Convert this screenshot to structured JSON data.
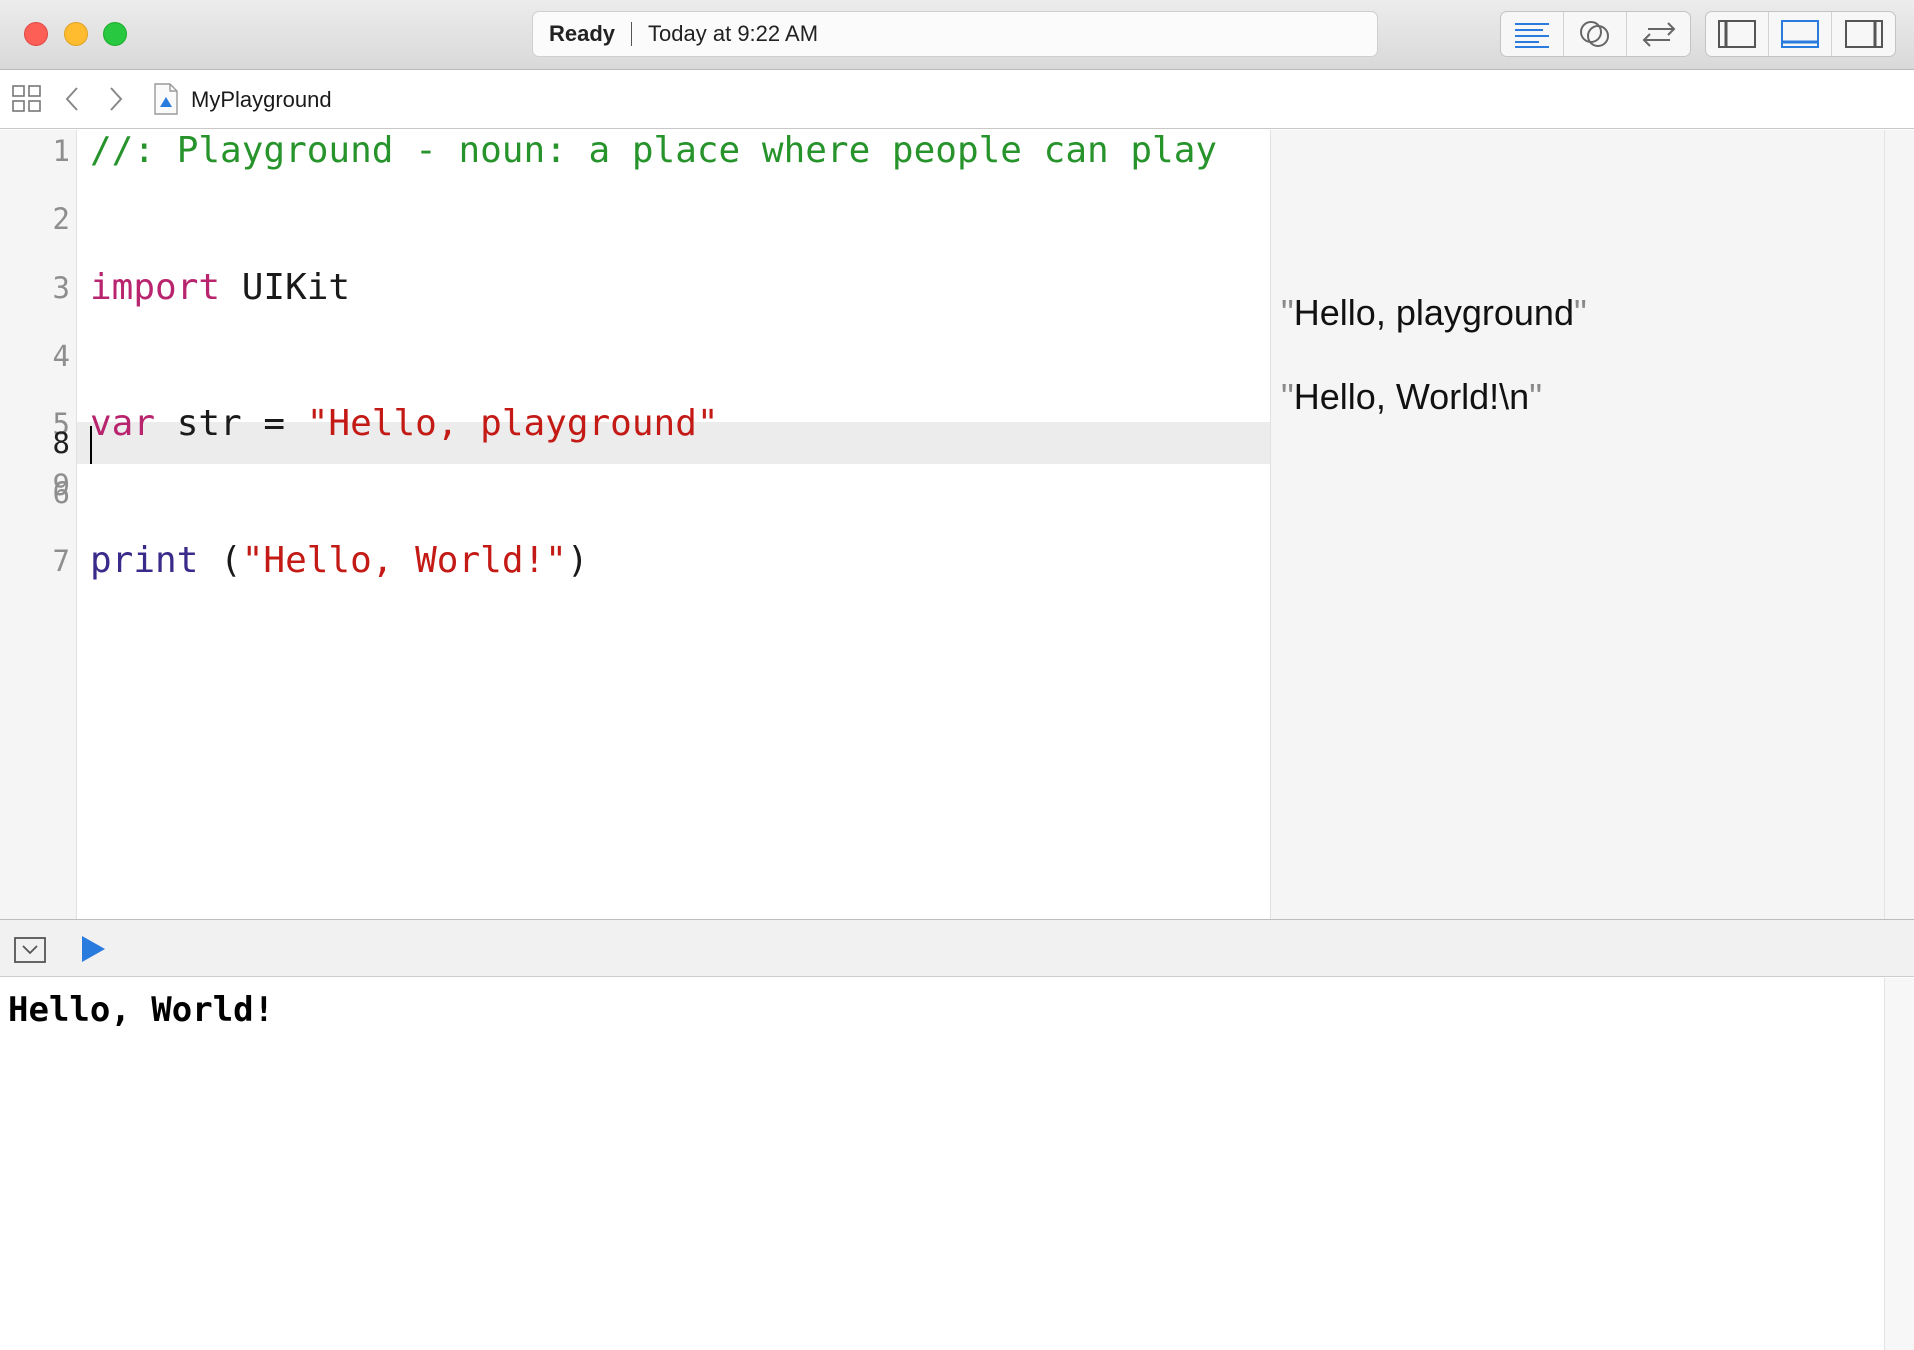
{
  "window": {
    "activity_status": "Ready",
    "activity_time": "Today at 9:22 AM",
    "editor_buttons": [
      "standard-editor-icon",
      "assistant-editor-icon",
      "version-editor-icon"
    ],
    "panel_buttons": [
      "navigator-toggle-icon",
      "debug-area-toggle-icon",
      "utilities-toggle-icon"
    ],
    "accent": "#2a7bde"
  },
  "jumpbar": {
    "file_name": "MyPlayground"
  },
  "editor": {
    "current_line": 8,
    "lines": [
      {
        "num": "1",
        "tokens": [
          {
            "cls": "t-comment",
            "text": "//: Playground - noun: a place where people can play"
          }
        ]
      },
      {
        "num": "2",
        "tokens": []
      },
      {
        "num": "3",
        "tokens": [
          {
            "cls": "t-keyword",
            "text": "import"
          },
          {
            "cls": "t-plain",
            "text": " UIKit"
          }
        ]
      },
      {
        "num": "4",
        "tokens": []
      },
      {
        "num": "5",
        "tokens": [
          {
            "cls": "t-keyword",
            "text": "var"
          },
          {
            "cls": "t-plain",
            "text": " str = "
          },
          {
            "cls": "t-string",
            "text": "\"Hello, playground\""
          }
        ]
      },
      {
        "num": "6",
        "tokens": []
      },
      {
        "num": "7",
        "tokens": [
          {
            "cls": "t-func",
            "text": "print"
          },
          {
            "cls": "t-plain",
            "text": " ("
          },
          {
            "cls": "t-string",
            "text": "\"Hello, World!\""
          },
          {
            "cls": "t-plain",
            "text": ")"
          }
        ]
      },
      {
        "num": "8",
        "tokens": []
      },
      {
        "num": "9",
        "tokens": []
      }
    ],
    "colors": {
      "comment": "#26932b",
      "keyword": "#b8246e",
      "string": "#c41a16",
      "function": "#3a2a8a"
    }
  },
  "results": {
    "line5_value": "Hello, playground",
    "line7_value": "Hello, World!\\n"
  },
  "console": {
    "output": "Hello, World!"
  }
}
